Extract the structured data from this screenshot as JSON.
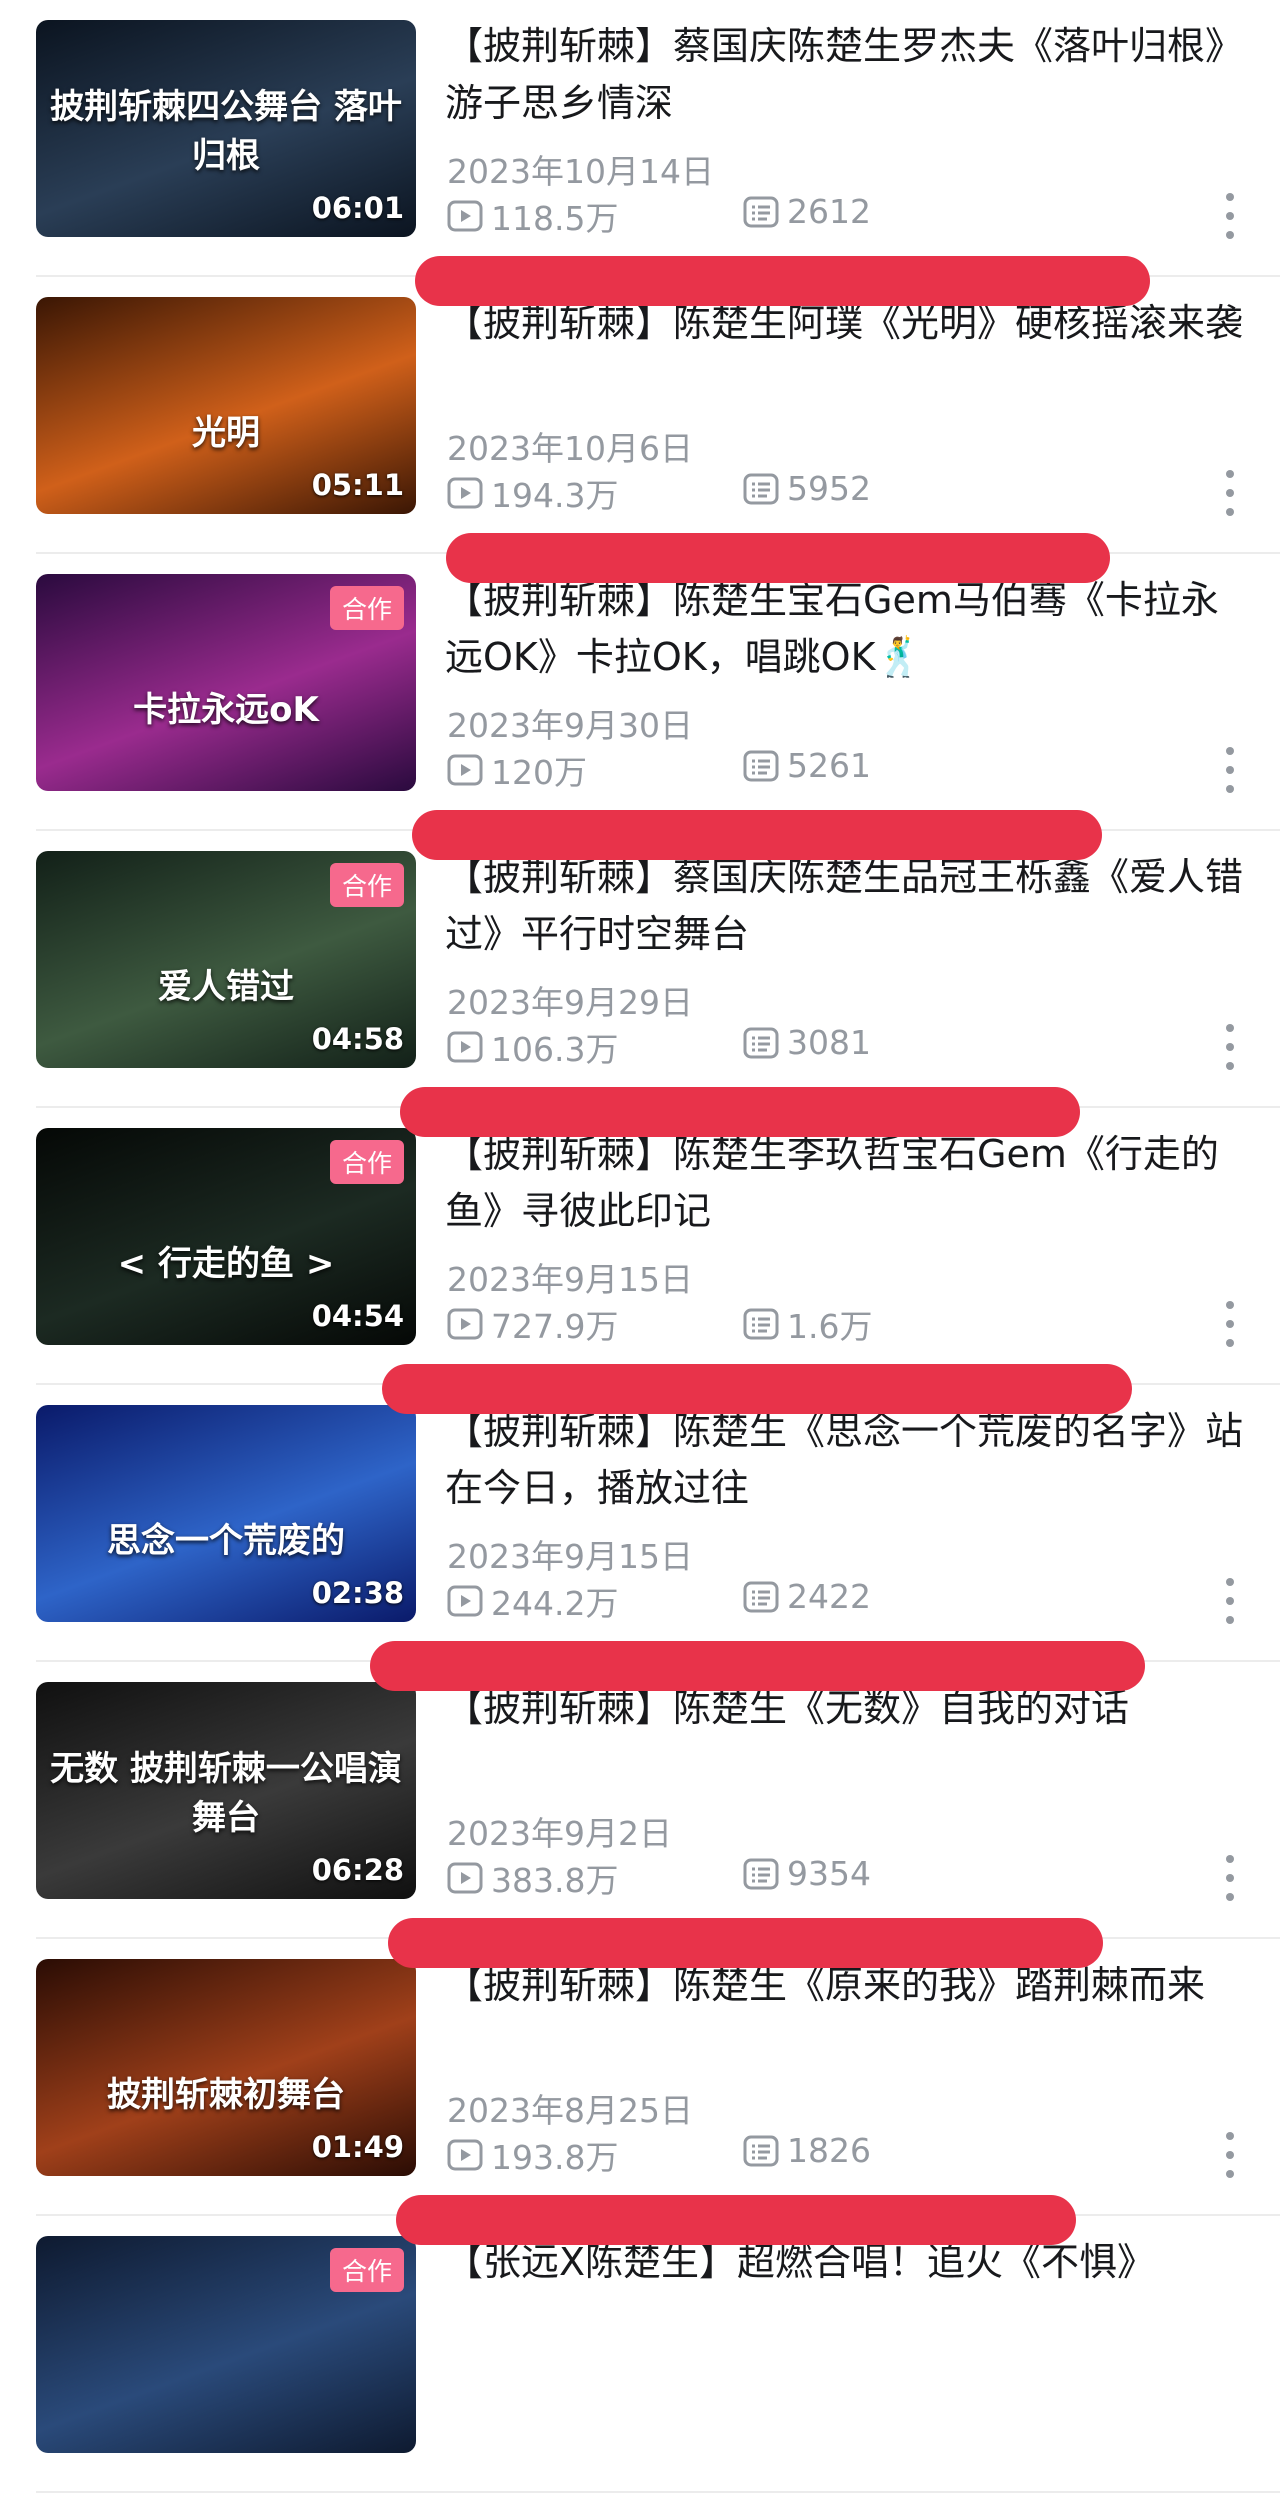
{
  "accent_color": "#f6698d",
  "redaction_color": "#e8334a",
  "videos": [
    {
      "title": "【披荆斩棘】蔡国庆陈楚生罗杰夫《落叶归根》游子思乡情深",
      "date": "2023年10月14日",
      "views": "118.5万",
      "danmaku": "2612",
      "duration": "06:01",
      "badge": "",
      "thumb_caption": "披荆斩棘四公舞台 落叶归根",
      "thumb_colors": [
        "#0b1420",
        "#2a3e56"
      ]
    },
    {
      "title": "【披荆斩棘】陈楚生阿璞《光明》硬核摇滚来袭",
      "date": "2023年10月6日",
      "views": "194.3万",
      "danmaku": "5952",
      "duration": "05:11",
      "badge": "",
      "thumb_caption": "光明",
      "thumb_colors": [
        "#3a1604",
        "#d0601a"
      ]
    },
    {
      "title": "【披荆斩棘】陈楚生宝石Gem马伯骞《卡拉永远OK》卡拉OK，唱跳OK🕺",
      "date": "2023年9月30日",
      "views": "120万",
      "danmaku": "5261",
      "duration": "",
      "badge": "合作",
      "thumb_caption": "卡拉永远oK",
      "thumb_colors": [
        "#2a0a3e",
        "#9a2b8e"
      ]
    },
    {
      "title": "【披荆斩棘】蔡国庆陈楚生品冠王栎鑫《爱人错过》平行时空舞台",
      "date": "2023年9月29日",
      "views": "106.3万",
      "danmaku": "3081",
      "duration": "04:58",
      "badge": "合作",
      "thumb_caption": "爱人错过",
      "thumb_colors": [
        "#122018",
        "#3e5a40"
      ]
    },
    {
      "title": "【披荆斩棘】陈楚生李玖哲宝石Gem《行走的鱼》寻彼此印记",
      "date": "2023年9月15日",
      "views": "727.9万",
      "danmaku": "1.6万",
      "duration": "04:54",
      "badge": "合作",
      "thumb_caption": "< 行走的鱼 >",
      "thumb_colors": [
        "#050806",
        "#1c2a22"
      ]
    },
    {
      "title": "【披荆斩棘】陈楚生《思念一个荒废的名字》站在今日，播放过往",
      "date": "2023年9月15日",
      "views": "244.2万",
      "danmaku": "2422",
      "duration": "02:38",
      "badge": "",
      "thumb_caption": "思念一个荒废的",
      "thumb_colors": [
        "#0a1a6a",
        "#2e64c8"
      ]
    },
    {
      "title": "【披荆斩棘】陈楚生《无数》自我的对话",
      "date": "2023年9月2日",
      "views": "383.8万",
      "danmaku": "9354",
      "duration": "06:28",
      "badge": "",
      "thumb_caption": "无数  披荆斩棘一公唱演舞台",
      "thumb_colors": [
        "#101010",
        "#3a3a3a"
      ]
    },
    {
      "title": "【披荆斩棘】陈楚生《原来的我》踏荆棘而来",
      "date": "2023年8月25日",
      "views": "193.8万",
      "danmaku": "1826",
      "duration": "01:49",
      "badge": "",
      "thumb_caption": "披荆斩棘初舞台",
      "thumb_colors": [
        "#2a0c04",
        "#a0401a"
      ]
    },
    {
      "title": "【张远X陈楚生】超燃合唱！追火《不惧》",
      "date": "",
      "views": "",
      "danmaku": "",
      "duration": "",
      "badge": "合作",
      "thumb_caption": "",
      "thumb_colors": [
        "#0e1a30",
        "#2a4a7a"
      ]
    }
  ]
}
